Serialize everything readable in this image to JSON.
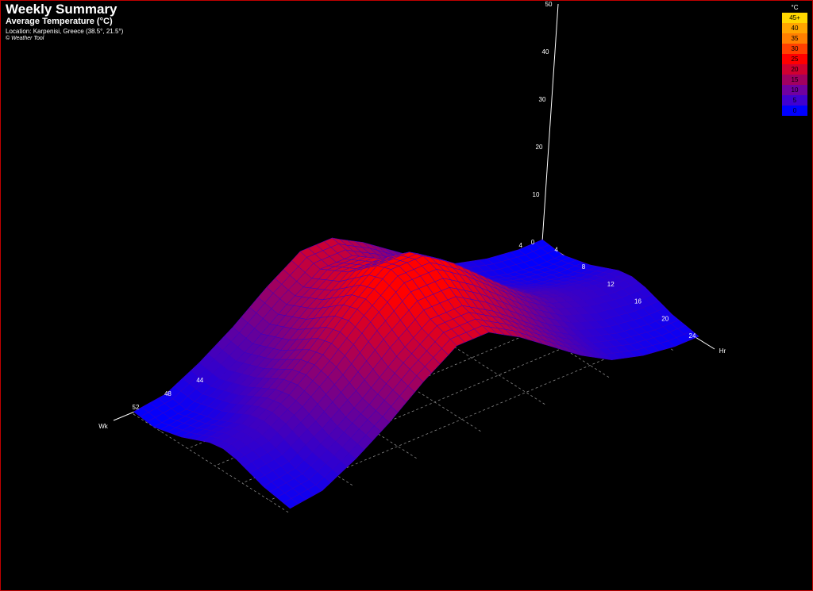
{
  "header": {
    "title": "Weekly Summary",
    "subtitle": "Average Temperature (°C)",
    "location": "Location: Karpenisi, Greece (38.5°, 21.5°)",
    "credit": "© Weather Tool"
  },
  "legend": {
    "unit": "°C",
    "items": [
      {
        "label": "45+",
        "color": "#ffd700"
      },
      {
        "label": "40",
        "color": "#ffa500"
      },
      {
        "label": "35",
        "color": "#ff7f00"
      },
      {
        "label": "30",
        "color": "#ff4000"
      },
      {
        "label": "25",
        "color": "#ff0000"
      },
      {
        "label": "20",
        "color": "#d00030"
      },
      {
        "label": "15",
        "color": "#a00060"
      },
      {
        "label": "10",
        "color": "#7000a0"
      },
      {
        "label": "5",
        "color": "#4000d0"
      },
      {
        "label": "0",
        "color": "#0000ff"
      }
    ]
  },
  "chart_data": {
    "type": "surface",
    "title": "Weekly Summary",
    "subtitle": "Average Temperature (°C)",
    "x_axis": {
      "label": "Hr",
      "ticks": [
        4,
        8,
        12,
        16,
        20,
        24
      ],
      "range": [
        1,
        24
      ]
    },
    "week_axis": {
      "label": "Wk",
      "ticks": [
        4,
        44,
        48,
        52
      ],
      "range": [
        1,
        52
      ]
    },
    "z_axis": {
      "ticks": [
        0,
        10,
        20,
        30,
        40,
        50
      ],
      "range": [
        0,
        50
      ]
    },
    "week_profile": {
      "weeks": [
        1,
        4,
        8,
        12,
        16,
        20,
        24,
        28,
        32,
        36,
        40,
        44,
        48,
        52
      ],
      "daily_mean_c": [
        2,
        2,
        3,
        5,
        9,
        14,
        19,
        23,
        23,
        18,
        12,
        7,
        3,
        2
      ]
    },
    "hour_profile": {
      "hours": [
        1,
        4,
        8,
        12,
        14,
        16,
        20,
        24
      ],
      "offset_c": [
        -3,
        -4,
        -1,
        4,
        5,
        4,
        0,
        -2
      ]
    }
  }
}
